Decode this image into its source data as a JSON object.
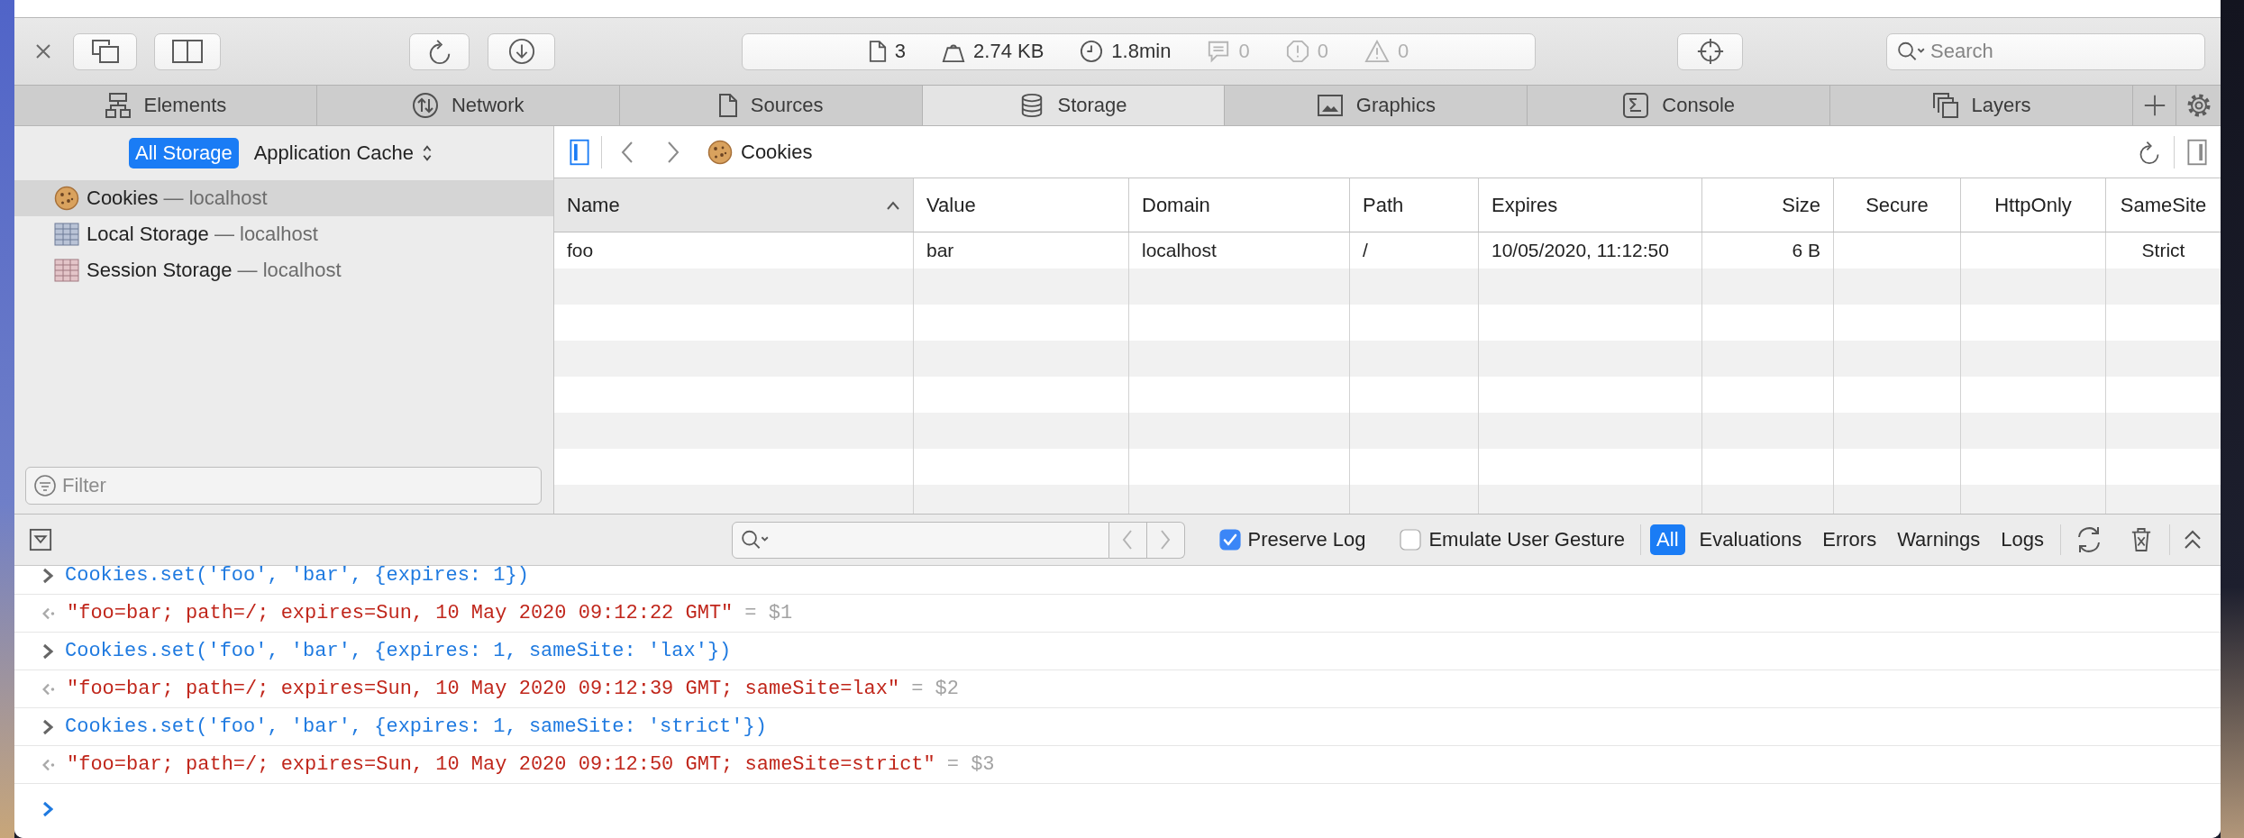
{
  "toolbar": {
    "stats": [
      {
        "kind": "resources",
        "text": "3",
        "disabled": false
      },
      {
        "kind": "size",
        "text": "2.74 KB",
        "disabled": false
      },
      {
        "kind": "time",
        "text": "1.8min",
        "disabled": false
      },
      {
        "kind": "logs",
        "text": "0",
        "disabled": true
      },
      {
        "kind": "errors",
        "text": "0",
        "disabled": true
      },
      {
        "kind": "warnings",
        "text": "0",
        "disabled": true
      }
    ],
    "search": {
      "placeholder": "Search"
    }
  },
  "tabs": [
    {
      "kind": "elements",
      "label": "Elements",
      "selected": false
    },
    {
      "kind": "network",
      "label": "Network",
      "selected": false
    },
    {
      "kind": "sources",
      "label": "Sources",
      "selected": false
    },
    {
      "kind": "storage",
      "label": "Storage",
      "selected": true
    },
    {
      "kind": "graphics",
      "label": "Graphics",
      "selected": false
    },
    {
      "kind": "console",
      "label": "Console",
      "selected": false
    },
    {
      "kind": "layers",
      "label": "Layers",
      "selected": false
    }
  ],
  "storage_sidebar": {
    "scope_bar": [
      {
        "kind": "toggle",
        "label": "All Storage",
        "selected": true
      },
      {
        "kind": "popup",
        "label": "Application Cache",
        "selected": false
      }
    ],
    "items": [
      {
        "kind": "cookies",
        "label": "Cookies",
        "detail": "— localhost",
        "selected": true
      },
      {
        "kind": "local",
        "label": "Local Storage",
        "detail": "— localhost",
        "selected": false
      },
      {
        "kind": "session",
        "label": "Session Storage",
        "detail": "— localhost",
        "selected": false
      }
    ],
    "filter": {
      "placeholder": "Filter"
    }
  },
  "content_bar": {
    "sidebar_toggle": {
      "on": true
    },
    "title": "Cookies",
    "details_toggle": {
      "on": false
    }
  },
  "table": {
    "columns": [
      {
        "label": "Name",
        "sorted": true
      },
      {
        "label": "Value",
        "sorted": false
      },
      {
        "label": "Domain",
        "sorted": false
      },
      {
        "label": "Path",
        "sorted": false
      },
      {
        "label": "Expires",
        "sorted": false
      },
      {
        "label": "Size",
        "sorted": false
      },
      {
        "label": "Secure",
        "sorted": false
      },
      {
        "label": "HttpOnly",
        "sorted": false
      },
      {
        "label": "SameSite",
        "sorted": false
      }
    ],
    "rows": [
      {
        "name": "foo",
        "value": "bar",
        "domain": "localhost",
        "path": "/",
        "expires": "10/05/2020, 11:12:50",
        "size": "6 B",
        "samesite": "Strict"
      }
    ]
  },
  "console_bar": {
    "checkboxes": [
      {
        "label": "Preserve Log",
        "checked": true
      },
      {
        "label": "Emulate User Gesture",
        "checked": false
      }
    ],
    "levels": [
      {
        "label": "All",
        "selected": true
      },
      {
        "label": "Evaluations",
        "selected": false
      },
      {
        "label": "Errors",
        "selected": false
      },
      {
        "label": "Warnings",
        "selected": false
      },
      {
        "label": "Logs",
        "selected": false
      }
    ]
  },
  "console": {
    "messages": [
      {
        "kind": "input",
        "text": "Cookies.set('foo', 'bar', {expires: 1})"
      },
      {
        "kind": "output",
        "text": "\"foo=bar; path=/; expires=Sun, 10 May 2020 09:12:22 GMT\"",
        "saved_as": "= $1"
      },
      {
        "kind": "input",
        "text": "Cookies.set('foo', 'bar', {expires: 1, sameSite: 'lax'})"
      },
      {
        "kind": "output",
        "text": "\"foo=bar; path=/; expires=Sun, 10 May 2020 09:12:39 GMT; sameSite=lax\"",
        "saved_as": "= $2"
      },
      {
        "kind": "input",
        "text": "Cookies.set('foo', 'bar', {expires: 1, sameSite: 'strict'})"
      },
      {
        "kind": "output",
        "text": "\"foo=bar; path=/; expires=Sun, 10 May 2020 09:12:50 GMT; sameSite=strict\"",
        "saved_as": "= $3"
      }
    ]
  }
}
